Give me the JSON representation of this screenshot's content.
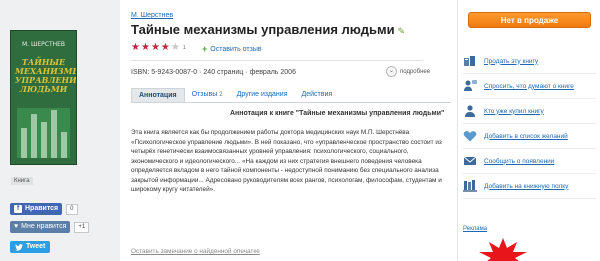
{
  "book": {
    "author": "М. Шерстнев",
    "title": "Тайные механизмы управления людьми",
    "rating": 4,
    "rating_max": 5,
    "rating_count": "1",
    "review_link": "Оставить отзыв",
    "isbn": "ISBN: 5-9243-0087-0",
    "pages": "240 страниц",
    "date": "февраль 2006",
    "meta_sep": "·",
    "more_label": "подробнее"
  },
  "cover": {
    "author": "М. ШЕРСТНЕВ",
    "title": "ТАЙНЫЕ МЕХАНИЗМЫ УПРАВЛЕНИЯ ЛЮДЬМИ",
    "background": "#2f6d3e",
    "title_color": "#d8c23a"
  },
  "left": {
    "kniga_label": "Книга"
  },
  "social": {
    "fb_label": "Нравится",
    "fb_count": "0",
    "vk_label": "Мне нравится",
    "vk_count": "+1",
    "tw_label": "Tweet"
  },
  "tabs": [
    {
      "label": "Аннотация",
      "badge": "",
      "active": true
    },
    {
      "label": "Отзывы",
      "badge": "2",
      "active": false
    },
    {
      "label": "Другие издания",
      "badge": "",
      "active": false
    },
    {
      "label": "Действия",
      "badge": "",
      "active": false
    }
  ],
  "annotation": {
    "heading": "Аннотация к книге \"Тайные механизмы управления людьми\"",
    "text": "Эта книга является как бы продолжением работы доктора медицинских наук М.П. Шерстнёва «Психологическое управление людьми». В ней показано, что «управленческое пространство состоит из четырёх генетически взаимосвязанных уровней управления: психологического, социального, экономического и идеологического... «На каждом из них стратегия внешнего поведения человека определяется вкладом в него тайной компоненты - недоступной пониманию без специального анализа закрытой информации... Адресовано руководителям всех рангов, психологам, философам, студентам и широкому кругу читателей».",
    "report_link": "Оставить замечание о найденной опечатке"
  },
  "sidebar": {
    "sale_label": "Нет в продаже",
    "actions": [
      {
        "label": "Продать эту книгу",
        "icon": "sell-icon"
      },
      {
        "label": "Спросить, что думают о книге",
        "icon": "ask-icon"
      },
      {
        "label": "Кто уже купил книгу",
        "icon": "buyers-icon"
      },
      {
        "label": "Добавить в список желаний",
        "icon": "wishlist-heart-icon"
      },
      {
        "label": "Сообщить о появлении",
        "icon": "notify-mail-icon"
      },
      {
        "label": "Добавить на книжную полку",
        "icon": "bookshelf-icon"
      }
    ],
    "ad_label": "Реклама"
  },
  "colors": {
    "link": "#1d69b7",
    "star": "#c0263f",
    "sale_button": "#f07a10",
    "facebook": "#4267b2",
    "vk": "#5b7fa6",
    "twitter": "#2b9fe6"
  }
}
